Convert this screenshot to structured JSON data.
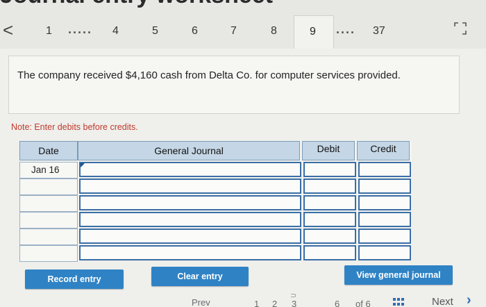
{
  "page": {
    "heading": "Journal entry worksheet"
  },
  "pager": {
    "prev": "<",
    "items": [
      "1",
      "4",
      "5",
      "6",
      "7",
      "8",
      "9",
      "37"
    ],
    "dots": ".....",
    "dots_short": "....",
    "active": "9"
  },
  "question": {
    "text": "The company received $4,160 cash from Delta Co. for computer services provided."
  },
  "note": "Note: Enter debits before credits.",
  "journal": {
    "headers": {
      "date": "Date",
      "account": "General Journal",
      "debit": "Debit",
      "credit": "Credit"
    },
    "rows": [
      {
        "date": "Jan 16",
        "account": "",
        "debit": "",
        "credit": ""
      },
      {
        "date": "",
        "account": "",
        "debit": "",
        "credit": ""
      },
      {
        "date": "",
        "account": "",
        "debit": "",
        "credit": ""
      },
      {
        "date": "",
        "account": "",
        "debit": "",
        "credit": ""
      },
      {
        "date": "",
        "account": "",
        "debit": "",
        "credit": ""
      },
      {
        "date": "",
        "account": "",
        "debit": "",
        "credit": ""
      }
    ]
  },
  "buttons": {
    "record": "Record entry",
    "clear": "Clear entry",
    "view": "View general journal"
  },
  "footer": {
    "prev": "Prev",
    "pages": [
      "1",
      "2",
      "3"
    ],
    "page_6": "6",
    "of": "of 6",
    "next": "Next"
  },
  "colors": {
    "accent": "#2f83c5",
    "header_bg": "#c5d7e6",
    "field_border": "#3a6ea5",
    "note": "#c0392b"
  }
}
